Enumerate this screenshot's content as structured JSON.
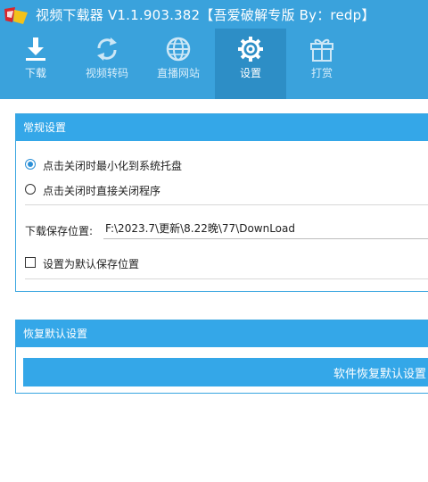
{
  "window": {
    "title": "视频下载器 V1.1.903.382【吾爱破解专版  By：redp】"
  },
  "nav": {
    "items": [
      {
        "label": "下载",
        "icon": "download-icon"
      },
      {
        "label": "视频转码",
        "icon": "convert-icon"
      },
      {
        "label": "直播网站",
        "icon": "globe-icon"
      },
      {
        "label": "设置",
        "icon": "gear-icon",
        "active": true
      },
      {
        "label": "打赏",
        "icon": "gift-icon"
      }
    ]
  },
  "general": {
    "heading": "常规设置",
    "close_options": [
      {
        "label": "点击关闭时最小化到系统托盘",
        "selected": true
      },
      {
        "label": "点击关闭时直接关闭程序",
        "selected": false
      }
    ],
    "save_path_label": "下载保存位置:",
    "save_path_value": "F:\\2023.7\\更新\\8.22晚\\77\\DownLoad",
    "default_checkbox_label": "设置为默认保存位置",
    "default_checked": false
  },
  "restore": {
    "heading": "恢复默认设置",
    "button_label": "软件恢复默认设置"
  },
  "colors": {
    "header_bg": "#3aa2dc",
    "active_tab": "#2d8ec6",
    "panel_head": "#34a7e8",
    "accent": "#2a8fd6"
  }
}
